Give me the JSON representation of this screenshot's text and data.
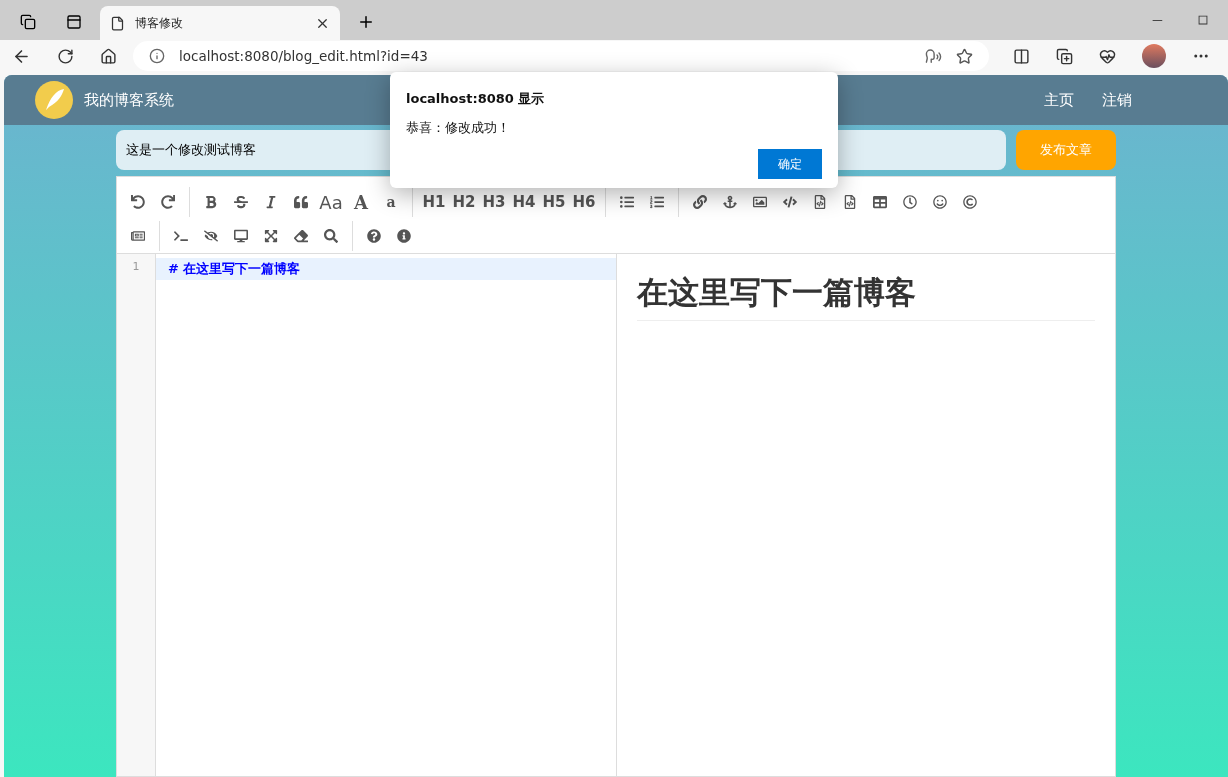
{
  "browser": {
    "tab": {
      "title": "博客修改",
      "selected": true
    },
    "url": "localhost:8080/blog_edit.html?id=43"
  },
  "navbar": {
    "brand": "我的博客系统",
    "links": [
      "主页",
      "注销"
    ]
  },
  "title_input": {
    "value": "这是一个修改测试博客"
  },
  "publish_button": "发布文章",
  "toolbar": {
    "text_buttons": [
      "Aa",
      "A",
      "a",
      "H1",
      "H2",
      "H3",
      "H4",
      "H5",
      "H6"
    ]
  },
  "editor": {
    "line_numbers": [
      "1"
    ],
    "lines": [
      {
        "text": "# 在这里写下一篇博客",
        "selected": true
      }
    ]
  },
  "preview": {
    "heading": "在这里写下一篇博客"
  },
  "dialog": {
    "title": "localhost:8080 显示",
    "message": "恭喜：修改成功！",
    "button": "确定"
  }
}
